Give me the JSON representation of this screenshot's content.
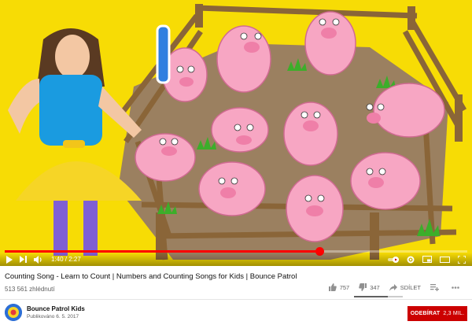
{
  "player": {
    "current_time": "1:40",
    "duration": "2:27",
    "time_separator": " / ",
    "progress_fraction": 0.68,
    "accent_color": "#ff0000",
    "scene": {
      "background_color": "#f7dc05",
      "pig_color": "#f7a6c3",
      "mud_color": "#9b8060",
      "fence_color": "#8a6538"
    },
    "controls_left": [
      "play-icon",
      "next-icon",
      "volume-icon"
    ],
    "controls_right": [
      "autoplay-toggle-icon",
      "settings-icon",
      "miniplayer-icon",
      "theater-icon",
      "fullscreen-icon"
    ]
  },
  "video": {
    "title": "Counting Song - Learn to Count | Numbers and Counting Songs for Kids | Bounce Patrol",
    "views": "513 561 zhlédnutí"
  },
  "actions": {
    "likes": "757",
    "dislikes": "347",
    "share": "SDÍLET",
    "sentiment_fraction": 0.69
  },
  "channel": {
    "name": "Bounce Patrol Kids",
    "published": "Publikováno 6. 5. 2017"
  },
  "subscribe": {
    "label": "ODEBÍRAT",
    "count": "2,3 MIL.",
    "color": "#cc0000"
  }
}
